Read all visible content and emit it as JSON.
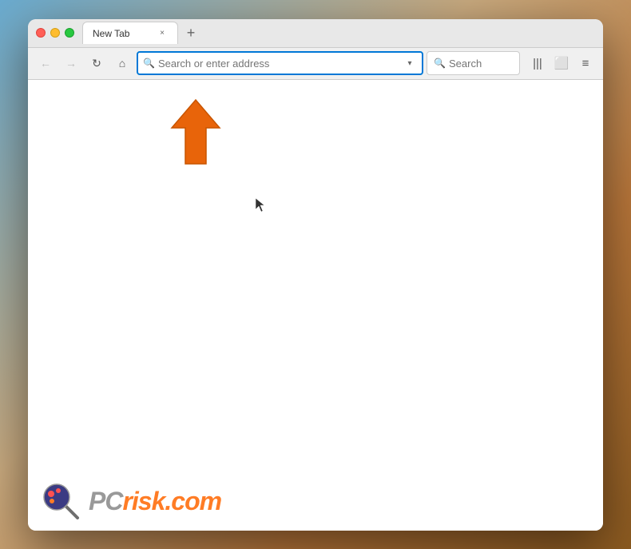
{
  "window": {
    "title": "New Tab",
    "traffic_lights": {
      "close_label": "close",
      "minimize_label": "minimize",
      "maximize_label": "maximize"
    }
  },
  "tab": {
    "label": "New Tab",
    "close_label": "×"
  },
  "new_tab_button": "+",
  "nav": {
    "back_icon": "←",
    "forward_icon": "→",
    "refresh_icon": "↻",
    "home_icon": "⌂",
    "address_placeholder": "Search or enter address",
    "dropdown_icon": "▾",
    "search_placeholder": "Search",
    "bookmarks_icon": "|||",
    "tabs_icon": "⬜",
    "menu_icon": "≡"
  },
  "content": {
    "arrow_color": "#e8640a",
    "cursor_visible": true
  },
  "watermark": {
    "brand": "PC",
    "suffix": "risk.com"
  }
}
